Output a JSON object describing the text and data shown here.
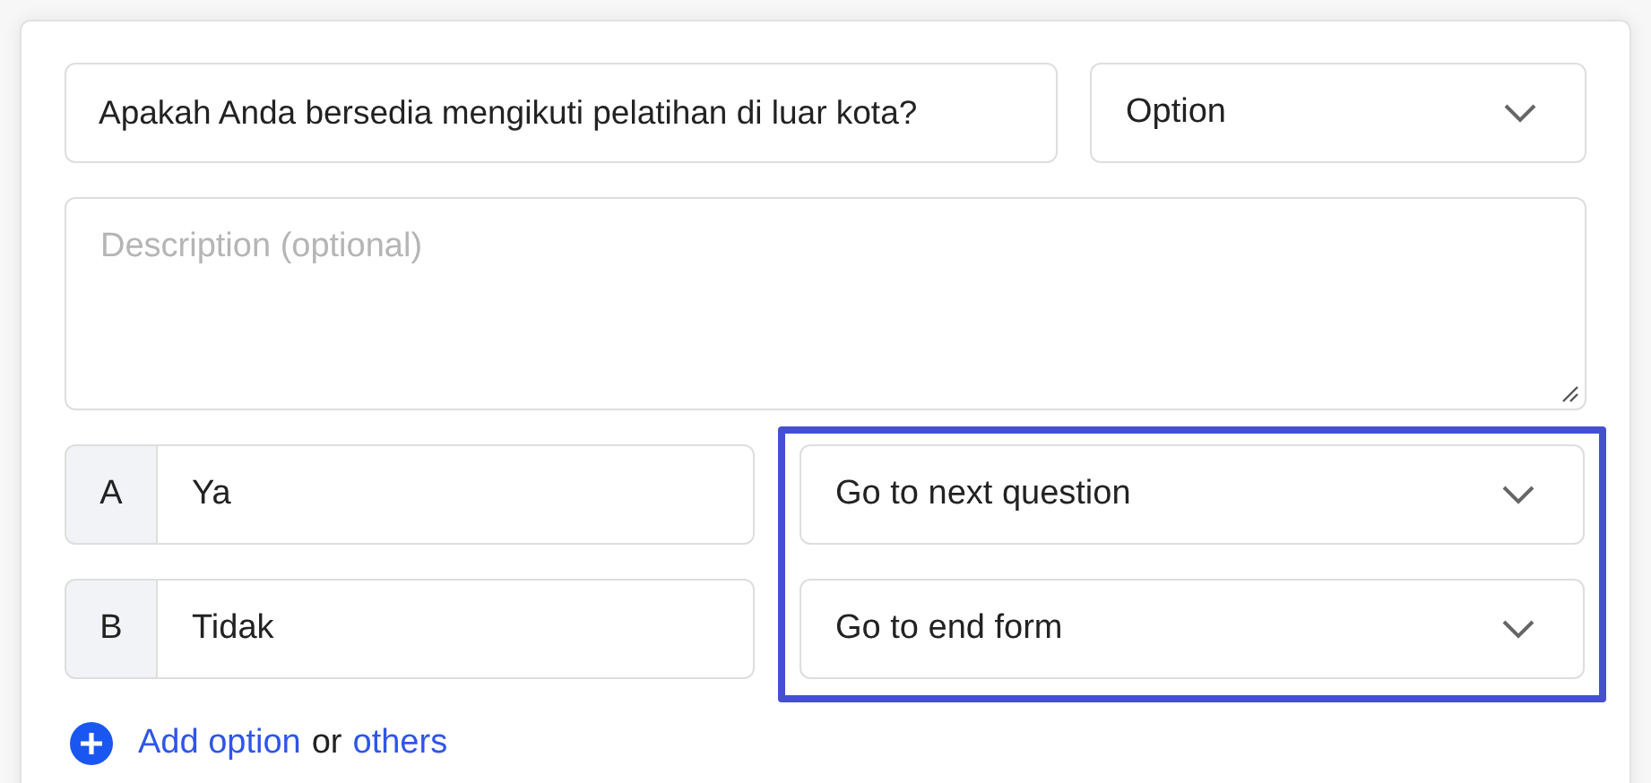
{
  "question": {
    "value": "Apakah Anda bersedia mengikuti pelatihan di luar kota?",
    "type": "Option"
  },
  "description": {
    "placeholder": "Description (optional)"
  },
  "options": [
    {
      "letter": "A",
      "value": "Ya",
      "action": "Go to next question"
    },
    {
      "letter": "B",
      "value": "Tidak",
      "action": "Go to end form"
    }
  ],
  "highlighted": true,
  "add": {
    "link": "Add option",
    "joiner": "or",
    "other_link": "others"
  }
}
